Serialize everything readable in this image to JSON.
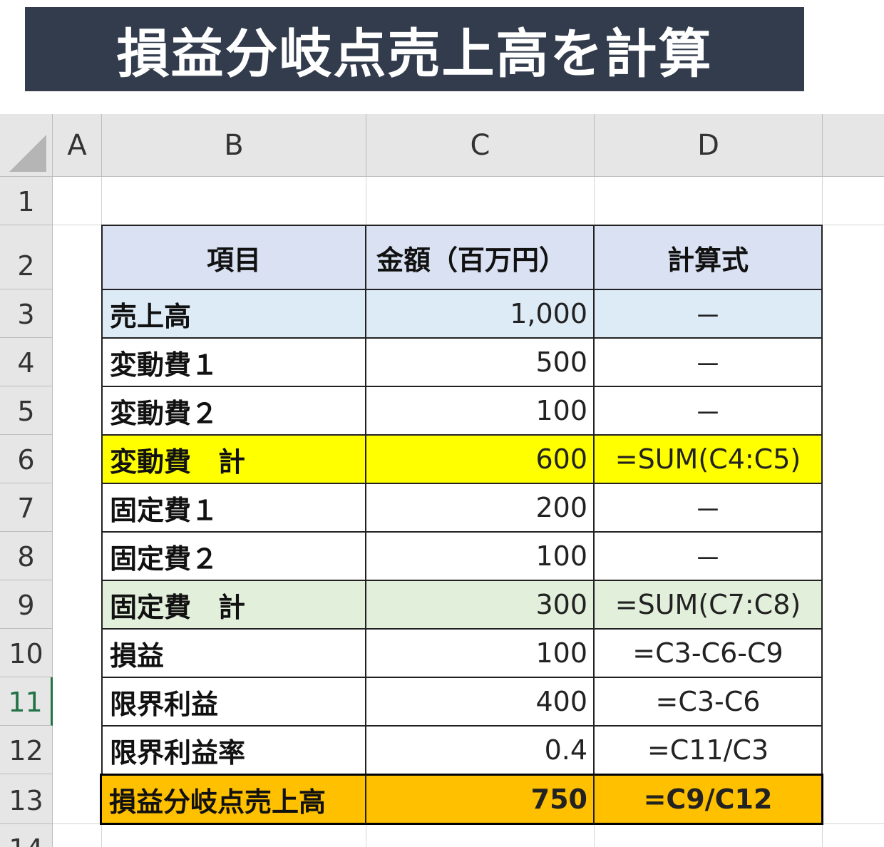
{
  "banner": {
    "title": "損益分岐点売上高を計算"
  },
  "sheet": {
    "columns": [
      "A",
      "B",
      "C",
      "D"
    ],
    "row_numbers": [
      "1",
      "2",
      "3",
      "4",
      "5",
      "6",
      "7",
      "8",
      "9",
      "10",
      "11",
      "12",
      "13",
      "14"
    ],
    "active_row": "11",
    "table": {
      "headers": [
        "項目",
        "金額（百万円）",
        "計算式"
      ],
      "rows": [
        {
          "item": "売上高",
          "amount": "1,000",
          "formula": "－"
        },
        {
          "item": "変動費１",
          "amount": "500",
          "formula": "－"
        },
        {
          "item": "変動費２",
          "amount": "100",
          "formula": "－"
        },
        {
          "item": "変動費　計",
          "amount": "600",
          "formula": "=SUM(C4:C5)"
        },
        {
          "item": "固定費１",
          "amount": "200",
          "formula": "－"
        },
        {
          "item": "固定費２",
          "amount": "100",
          "formula": "－"
        },
        {
          "item": "固定費　計",
          "amount": "300",
          "formula": "=SUM(C7:C8)"
        },
        {
          "item": "損益",
          "amount": "100",
          "formula": "=C3-C6-C9"
        },
        {
          "item": "限界利益",
          "amount": "400",
          "formula": "=C3-C6"
        },
        {
          "item": "限界利益率",
          "amount": "0.4",
          "formula": "=C11/C3"
        },
        {
          "item": "損益分岐点売上高",
          "amount": "750",
          "formula": "=C9/C12"
        }
      ]
    },
    "colors": {
      "header_fill": "#d9e1f2",
      "sales_fill": "#ddebf7",
      "variable_total_fill": "#ffff00",
      "fixed_total_fill": "#e2efda",
      "result_fill": "#ffc000",
      "banner_fill": "#323c4d"
    }
  }
}
